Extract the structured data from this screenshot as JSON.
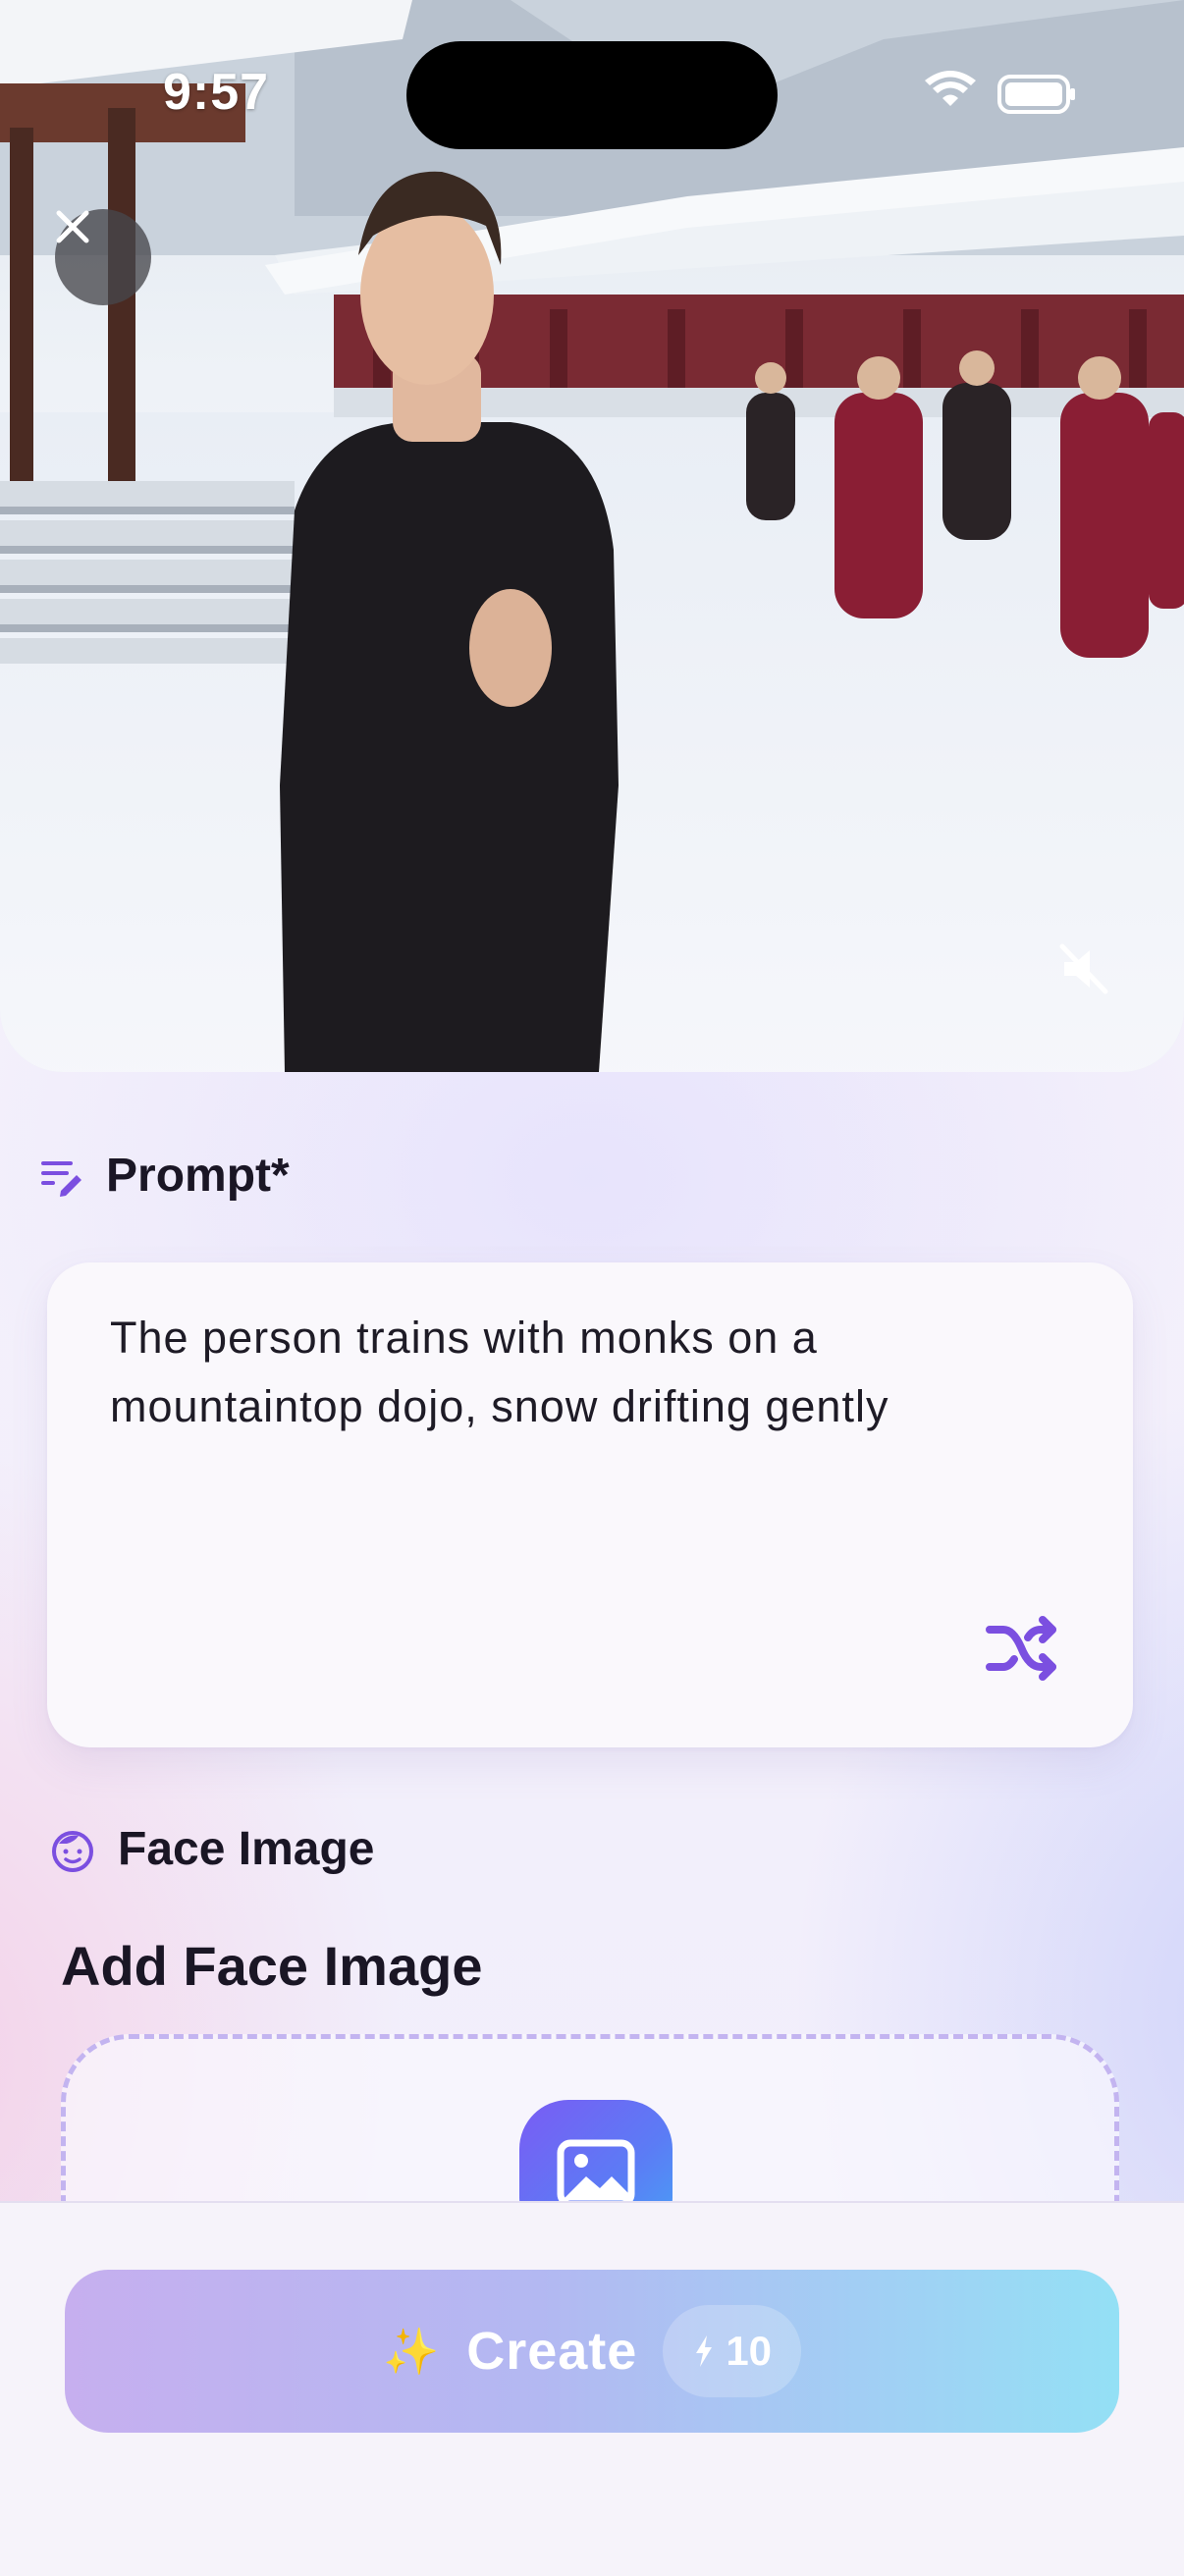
{
  "status_bar": {
    "time": "9:57"
  },
  "hero": {
    "media": "snowy-dojo-training-video"
  },
  "prompt": {
    "label": "Prompt*",
    "text": "The person trains with monks on a mountaintop dojo, snow drifting gently"
  },
  "face": {
    "label": "Face Image",
    "title": "Add Face Image"
  },
  "create": {
    "label": "Create",
    "cost": "10"
  },
  "colors": {
    "accent": "#7b4fe0",
    "button_start": "#c6afef",
    "button_end": "#94e0f5"
  },
  "icons": [
    "close-icon",
    "mute-icon",
    "prompt-edit-icon",
    "shuffle-icon",
    "face-icon",
    "image-icon",
    "sparkle-icon",
    "bolt-icon",
    "wifi-icon",
    "battery-icon"
  ]
}
